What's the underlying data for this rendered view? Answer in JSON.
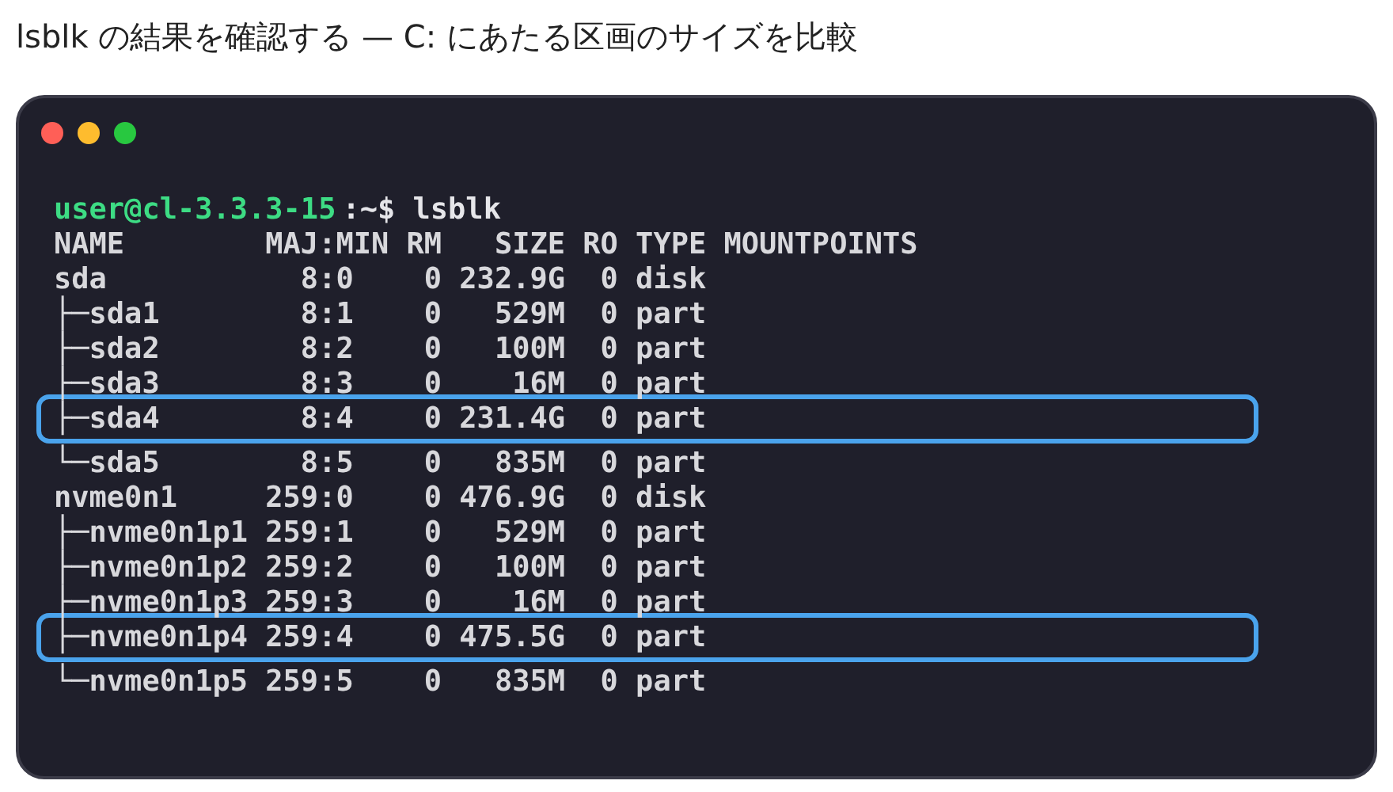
{
  "heading": "lsblk の結果を確認する — C: にあたる区画のサイズを比較",
  "terminal": {
    "prompt": {
      "user_host": "user@cl-3.3.3-15",
      "command": ":~$ lsblk"
    },
    "lines": [
      {
        "text": "NAME        MAJ:MIN RM   SIZE RO TYPE MOUNTPOINTS",
        "highlighted": false
      },
      {
        "text": "sda           8:0    0 232.9G  0 disk",
        "highlighted": false
      },
      {
        "text": "├─sda1        8:1    0   529M  0 part",
        "highlighted": false
      },
      {
        "text": "├─sda2        8:2    0   100M  0 part",
        "highlighted": false
      },
      {
        "text": "├─sda3        8:3    0    16M  0 part",
        "highlighted": false
      },
      {
        "text": "├─sda4        8:4    0 231.4G  0 part",
        "highlighted": true
      },
      {
        "text": "└─sda5        8:5    0   835M  0 part",
        "highlighted": false
      },
      {
        "text": "nvme0n1     259:0    0 476.9G  0 disk",
        "highlighted": false
      },
      {
        "text": "├─nvme0n1p1 259:1    0   529M  0 part",
        "highlighted": false
      },
      {
        "text": "├─nvme0n1p2 259:2    0   100M  0 part",
        "highlighted": false
      },
      {
        "text": "├─nvme0n1p3 259:3    0    16M  0 part",
        "highlighted": false
      },
      {
        "text": "├─nvme0n1p4 259:4    0 475.5G  0 part",
        "highlighted": true
      },
      {
        "text": "└─nvme0n1p5 259:5    0   835M  0 part",
        "highlighted": false
      }
    ]
  }
}
